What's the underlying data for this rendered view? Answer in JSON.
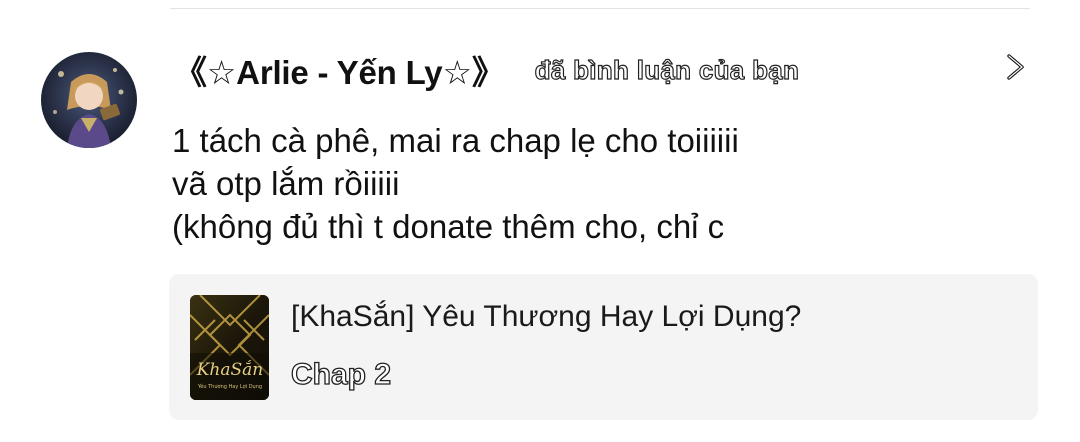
{
  "notification": {
    "user_name": "《☆Arlie - Yến Ly☆》",
    "action_text": "đã bình luận của bạn",
    "comment_text": "1 tách cà phê, mai ra chap lẹ cho toiiiiii\nvã otp lắm rồiiiii\n(không đủ thì t donate thêm cho, chỉ c",
    "avatar_icon": "user-avatar",
    "open_icon": "chevron-right-icon"
  },
  "story_card": {
    "title": "[KhaSắn] Yêu Thương Hay Lợi Dụng?",
    "chapter": "Chap 2",
    "cover_logo": "KhaSắn",
    "cover_subtitle": "Yêu Thương Hay Lợi Dụng",
    "cover_colors": [
      "#1a1608",
      "#c9a646"
    ]
  }
}
